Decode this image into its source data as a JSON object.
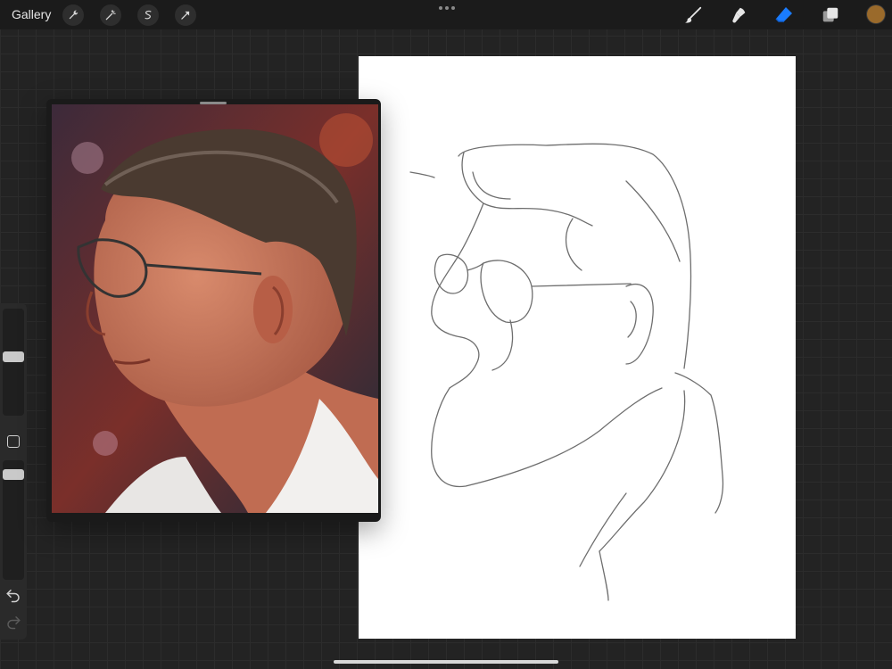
{
  "topbar": {
    "gallery_label": "Gallery",
    "left_tools": [
      "wrench-icon",
      "magic-wand-icon",
      "selection-icon",
      "transform-icon"
    ],
    "right_tools": [
      "brush-icon",
      "smudge-icon",
      "eraser-icon",
      "layers-icon"
    ],
    "active_tool": "eraser-icon",
    "current_color": "#9a6a2b"
  },
  "sidebar": {
    "brush_size_level": 0.5,
    "opacity_level": 0.2,
    "controls": [
      "modify-button",
      "undo-button",
      "redo-button"
    ]
  },
  "canvas": {
    "content": "pencil-caricature-sketch"
  },
  "reference": {
    "content": "portrait-photo-of-man-with-glasses"
  },
  "colors": {
    "accent": "#1a7cff",
    "background": "#232323",
    "toolbar": "#1b1b1b"
  }
}
